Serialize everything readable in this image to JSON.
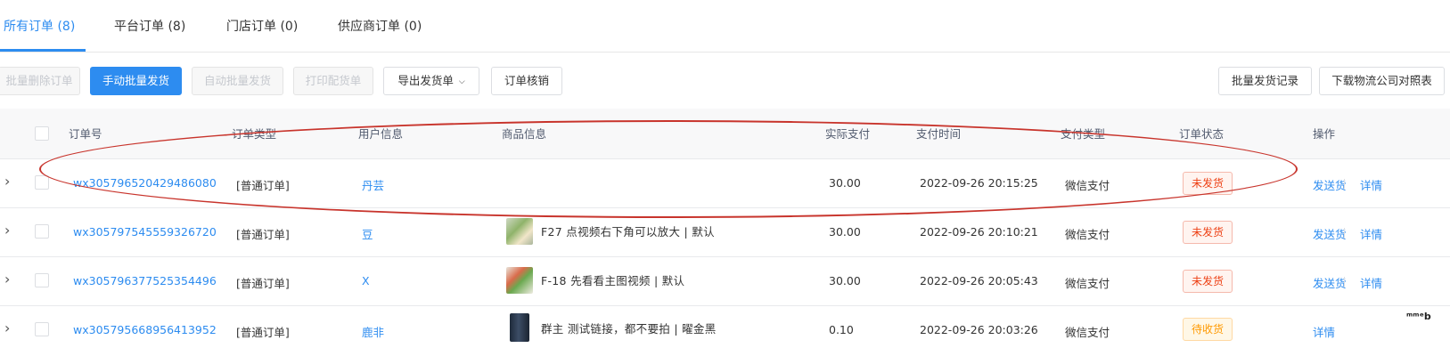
{
  "tabs": [
    {
      "label": "所有订单 (8)"
    },
    {
      "label": "平台订单 (8)"
    },
    {
      "label": "门店订单 (0)"
    },
    {
      "label": "供应商订单 (0)"
    }
  ],
  "toolbar": {
    "batch_delete": "批量删除订单",
    "manual_batch_ship": "手动批量发货",
    "auto_batch_ship": "自动批量发货",
    "print_picking": "打印配货单",
    "export_shipping": "导出发货单",
    "order_verify": "订单核销",
    "batch_ship_records": "批量发货记录",
    "download_logistics": "下载物流公司对照表"
  },
  "table": {
    "headers": {
      "order_no": "订单号",
      "order_type": "订单类型",
      "user_info": "用户信息",
      "product_info": "商品信息",
      "paid": "实际支付",
      "pay_time": "支付时间",
      "pay_type": "支付类型",
      "status": "订单状态",
      "actions": "操作"
    },
    "rows": [
      {
        "order_no": "wx305796520429486080",
        "type": "[普通订单]",
        "user": "丹芸",
        "product": "",
        "paid": "30.00",
        "time": "2022-09-26 20:15:25",
        "pay_type": "微信支付",
        "status": "未发货",
        "action1": "发送货",
        "action2": "详情"
      },
      {
        "order_no": "wx305797545559326720",
        "type": "[普通订单]",
        "user": "豆",
        "product": "F27 点视频右下角可以放大 | 默认",
        "paid": "30.00",
        "time": "2022-09-26 20:10:21",
        "pay_type": "微信支付",
        "status": "未发货",
        "action1": "发送货",
        "action2": "详情"
      },
      {
        "order_no": "wx305796377525354496",
        "type": "[普通订单]",
        "user": "X",
        "product": "F-18 先看看主图视频 | 默认",
        "paid": "30.00",
        "time": "2022-09-26 20:05:43",
        "pay_type": "微信支付",
        "status": "未发货",
        "action1": "发送货",
        "action2": "详情"
      },
      {
        "order_no": "wx305795668956413952",
        "type": "[普通订单]",
        "user": "鹿非",
        "product": "群主 测试链接，都不要拍 | 曜金黑",
        "paid": "0.10",
        "time": "2022-09-26 20:03:26",
        "pay_type": "微信支付",
        "status": "待收货",
        "action2": "详情"
      }
    ]
  },
  "watermark": "ᵐᵐᵉb",
  "colors": {
    "accent": "#2d8cf0",
    "status_unshipped": "#ed4014",
    "status_pending": "#ff9900",
    "annotation": "#c8342c"
  }
}
